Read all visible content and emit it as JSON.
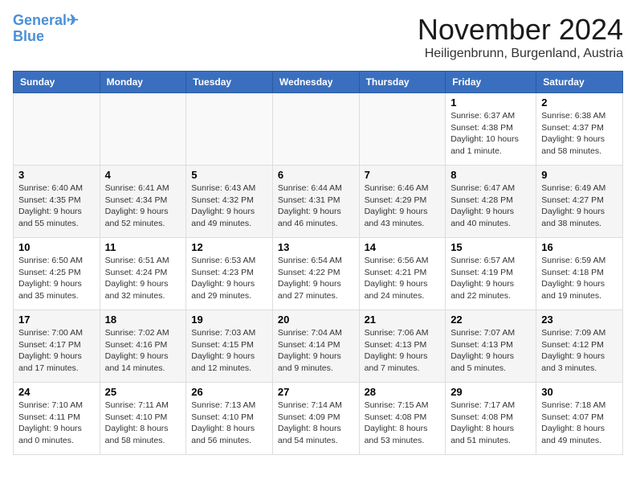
{
  "logo": {
    "line1": "General",
    "line2": "Blue"
  },
  "title": "November 2024",
  "subtitle": "Heiligenbrunn, Burgenland, Austria",
  "days_of_week": [
    "Sunday",
    "Monday",
    "Tuesday",
    "Wednesday",
    "Thursday",
    "Friday",
    "Saturday"
  ],
  "weeks": [
    [
      {
        "day": "",
        "info": ""
      },
      {
        "day": "",
        "info": ""
      },
      {
        "day": "",
        "info": ""
      },
      {
        "day": "",
        "info": ""
      },
      {
        "day": "",
        "info": ""
      },
      {
        "day": "1",
        "info": "Sunrise: 6:37 AM\nSunset: 4:38 PM\nDaylight: 10 hours\nand 1 minute."
      },
      {
        "day": "2",
        "info": "Sunrise: 6:38 AM\nSunset: 4:37 PM\nDaylight: 9 hours\nand 58 minutes."
      }
    ],
    [
      {
        "day": "3",
        "info": "Sunrise: 6:40 AM\nSunset: 4:35 PM\nDaylight: 9 hours\nand 55 minutes."
      },
      {
        "day": "4",
        "info": "Sunrise: 6:41 AM\nSunset: 4:34 PM\nDaylight: 9 hours\nand 52 minutes."
      },
      {
        "day": "5",
        "info": "Sunrise: 6:43 AM\nSunset: 4:32 PM\nDaylight: 9 hours\nand 49 minutes."
      },
      {
        "day": "6",
        "info": "Sunrise: 6:44 AM\nSunset: 4:31 PM\nDaylight: 9 hours\nand 46 minutes."
      },
      {
        "day": "7",
        "info": "Sunrise: 6:46 AM\nSunset: 4:29 PM\nDaylight: 9 hours\nand 43 minutes."
      },
      {
        "day": "8",
        "info": "Sunrise: 6:47 AM\nSunset: 4:28 PM\nDaylight: 9 hours\nand 40 minutes."
      },
      {
        "day": "9",
        "info": "Sunrise: 6:49 AM\nSunset: 4:27 PM\nDaylight: 9 hours\nand 38 minutes."
      }
    ],
    [
      {
        "day": "10",
        "info": "Sunrise: 6:50 AM\nSunset: 4:25 PM\nDaylight: 9 hours\nand 35 minutes."
      },
      {
        "day": "11",
        "info": "Sunrise: 6:51 AM\nSunset: 4:24 PM\nDaylight: 9 hours\nand 32 minutes."
      },
      {
        "day": "12",
        "info": "Sunrise: 6:53 AM\nSunset: 4:23 PM\nDaylight: 9 hours\nand 29 minutes."
      },
      {
        "day": "13",
        "info": "Sunrise: 6:54 AM\nSunset: 4:22 PM\nDaylight: 9 hours\nand 27 minutes."
      },
      {
        "day": "14",
        "info": "Sunrise: 6:56 AM\nSunset: 4:21 PM\nDaylight: 9 hours\nand 24 minutes."
      },
      {
        "day": "15",
        "info": "Sunrise: 6:57 AM\nSunset: 4:19 PM\nDaylight: 9 hours\nand 22 minutes."
      },
      {
        "day": "16",
        "info": "Sunrise: 6:59 AM\nSunset: 4:18 PM\nDaylight: 9 hours\nand 19 minutes."
      }
    ],
    [
      {
        "day": "17",
        "info": "Sunrise: 7:00 AM\nSunset: 4:17 PM\nDaylight: 9 hours\nand 17 minutes."
      },
      {
        "day": "18",
        "info": "Sunrise: 7:02 AM\nSunset: 4:16 PM\nDaylight: 9 hours\nand 14 minutes."
      },
      {
        "day": "19",
        "info": "Sunrise: 7:03 AM\nSunset: 4:15 PM\nDaylight: 9 hours\nand 12 minutes."
      },
      {
        "day": "20",
        "info": "Sunrise: 7:04 AM\nSunset: 4:14 PM\nDaylight: 9 hours\nand 9 minutes."
      },
      {
        "day": "21",
        "info": "Sunrise: 7:06 AM\nSunset: 4:13 PM\nDaylight: 9 hours\nand 7 minutes."
      },
      {
        "day": "22",
        "info": "Sunrise: 7:07 AM\nSunset: 4:13 PM\nDaylight: 9 hours\nand 5 minutes."
      },
      {
        "day": "23",
        "info": "Sunrise: 7:09 AM\nSunset: 4:12 PM\nDaylight: 9 hours\nand 3 minutes."
      }
    ],
    [
      {
        "day": "24",
        "info": "Sunrise: 7:10 AM\nSunset: 4:11 PM\nDaylight: 9 hours\nand 0 minutes."
      },
      {
        "day": "25",
        "info": "Sunrise: 7:11 AM\nSunset: 4:10 PM\nDaylight: 8 hours\nand 58 minutes."
      },
      {
        "day": "26",
        "info": "Sunrise: 7:13 AM\nSunset: 4:10 PM\nDaylight: 8 hours\nand 56 minutes."
      },
      {
        "day": "27",
        "info": "Sunrise: 7:14 AM\nSunset: 4:09 PM\nDaylight: 8 hours\nand 54 minutes."
      },
      {
        "day": "28",
        "info": "Sunrise: 7:15 AM\nSunset: 4:08 PM\nDaylight: 8 hours\nand 53 minutes."
      },
      {
        "day": "29",
        "info": "Sunrise: 7:17 AM\nSunset: 4:08 PM\nDaylight: 8 hours\nand 51 minutes."
      },
      {
        "day": "30",
        "info": "Sunrise: 7:18 AM\nSunset: 4:07 PM\nDaylight: 8 hours\nand 49 minutes."
      }
    ]
  ]
}
